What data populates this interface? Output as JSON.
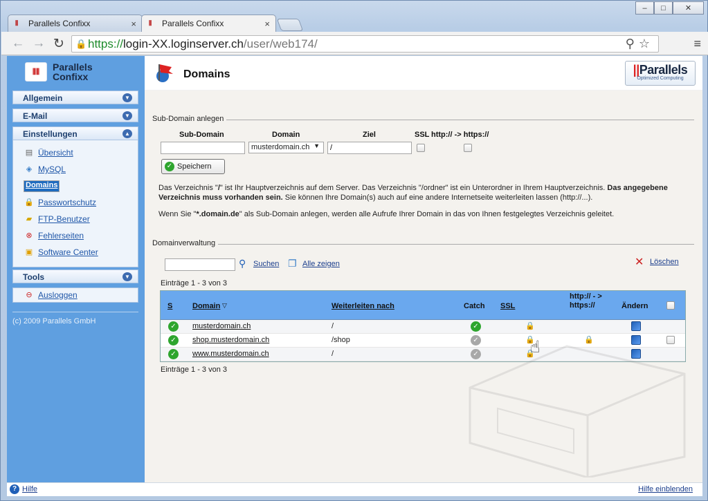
{
  "browser": {
    "tabs": [
      {
        "title": "Parallels Confixx"
      },
      {
        "title": "Parallels Confixx"
      }
    ],
    "url": {
      "scheme": "https://",
      "host": "login-XX.loginserver.ch",
      "path": "/user/web174/"
    }
  },
  "sidebar": {
    "logo": {
      "line1": "Parallels",
      "line2": "Confixx"
    },
    "sections": {
      "allgemein": "Allgemein",
      "email": "E-Mail",
      "einstellungen": "Einstellungen",
      "tools": "Tools"
    },
    "items": [
      {
        "label": "Übersicht",
        "icon": "overview-icon"
      },
      {
        "label": "MySQL",
        "icon": "mysql-icon"
      },
      {
        "label": "Domains",
        "icon": "domains-icon"
      },
      {
        "label": "Passwortschutz",
        "icon": "lock-icon"
      },
      {
        "label": "FTP-Benutzer",
        "icon": "ftp-icon"
      },
      {
        "label": "Fehlerseiten",
        "icon": "error-page-icon"
      },
      {
        "label": "Software Center",
        "icon": "software-icon"
      }
    ],
    "logout": "Ausloggen",
    "copyright": "(c) 2009 Parallels GmbH"
  },
  "header": {
    "title": "Domains",
    "brand": "Parallels",
    "brand_sub": "Optimized Computing"
  },
  "subdomain": {
    "legend": "Sub-Domain anlegen",
    "col_subdomain": "Sub-Domain",
    "col_domain": "Domain",
    "col_ziel": "Ziel",
    "col_ssl": "SSL",
    "col_redirect": "http:// -> https://",
    "subdomain_value": "",
    "domain_selected": "musterdomain.ch",
    "ziel_value": "/",
    "save_label": "Speichern"
  },
  "info": {
    "p1a": "Das Verzeichnis \"",
    "p1b": "/",
    "p1c": "\" ist Ihr Hauptverzeichnis auf dem Server. Das Verzeichnis \"/ordner\" ist ein Unterordner in Ihrem Hauptverzeichnis. ",
    "p1d": "Das angegebene Verzeichnis muss vorhanden sein.",
    "p1e": " Sie können Ihre Domain(s) auch auf eine andere Internetseite weiterleiten lassen (http://...).",
    "p2a": "Wenn Sie \"",
    "p2b": "*.domain.de",
    "p2c": "\" als Sub-Domain anlegen, werden alle Aufrufe Ihrer Domain in das von Ihnen festgelegtes Verzeichnis geleitet."
  },
  "domainverwaltung": {
    "legend": "Domainverwaltung",
    "search_value": "",
    "search_label": "Suchen",
    "show_all": "Alle zeigen",
    "delete_label": "Löschen",
    "count_top": "Einträge 1 - 3 von 3",
    "count_bottom": "Einträge 1 - 3 von 3",
    "columns": {
      "s": "S",
      "domain": "Domain",
      "weiterleiten": "Weiterleiten nach",
      "catch": "Catch",
      "ssl": "SSL",
      "redirect": "http:// - > https://",
      "aendern": "Ändern"
    },
    "rows": [
      {
        "domain": "musterdomain.ch",
        "target": "/",
        "catch": "on"
      },
      {
        "domain": "shop.musterdomain.ch",
        "target": "/shop",
        "catch": "off"
      },
      {
        "domain": "www.musterdomain.ch",
        "target": "/",
        "catch": "off"
      }
    ]
  },
  "status": {
    "help": "Hilfe",
    "show_help": "Hilfe einblenden"
  }
}
